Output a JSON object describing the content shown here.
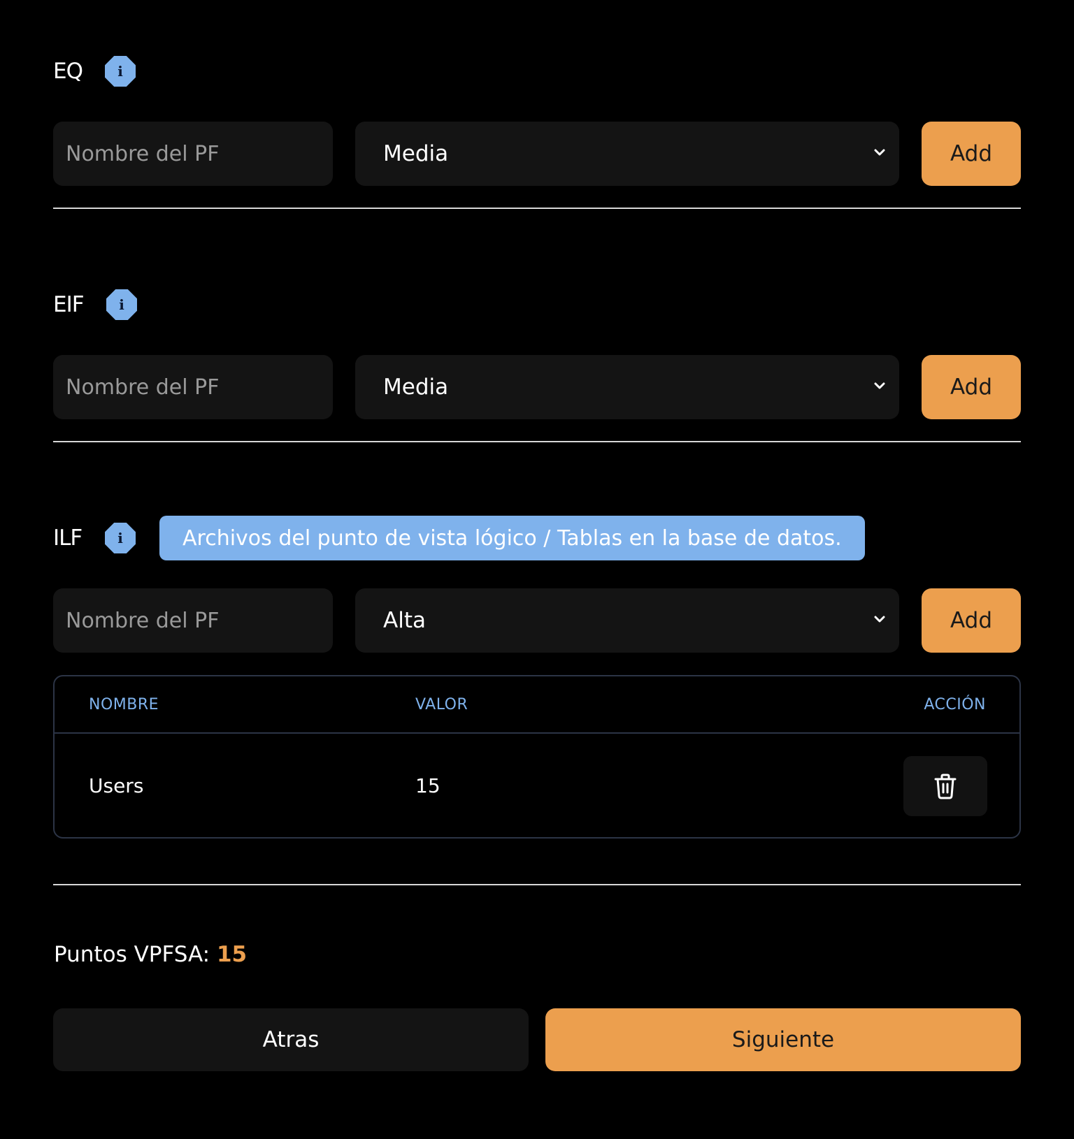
{
  "sections": [
    {
      "title": "EQ",
      "input_placeholder": "Nombre del PF",
      "select_value": "Media",
      "add_label": "Add"
    },
    {
      "title": "EIF",
      "input_placeholder": "Nombre del PF",
      "select_value": "Media",
      "add_label": "Add"
    },
    {
      "title": "ILF",
      "tooltip": "Archivos del punto de vista lógico / Tablas en la base de datos.",
      "input_placeholder": "Nombre del PF",
      "select_value": "Alta",
      "add_label": "Add",
      "table": {
        "headers": [
          "NOMBRE",
          "VALOR",
          "ACCIÓN"
        ],
        "rows": [
          {
            "nombre": "Users",
            "valor": "15"
          }
        ]
      }
    }
  ],
  "info_icon": "info-icon",
  "delete_icon": "trash-icon",
  "points": {
    "label": "Puntos VPFSA:",
    "value": "15"
  },
  "nav": {
    "back_label": "Atras",
    "next_label": "Siguiente"
  },
  "colors": {
    "background": "#000000",
    "accent": "#ec9f4e",
    "info_blue": "#7fb2ec",
    "field_bg": "#141414",
    "table_border": "#2c3446"
  }
}
